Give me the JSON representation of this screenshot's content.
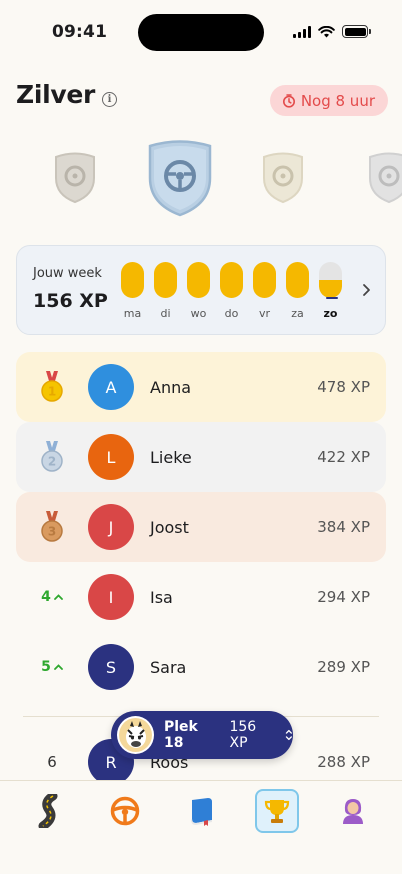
{
  "status": {
    "time": "09:41"
  },
  "header": {
    "title": "Zilver",
    "info_icon": "info-icon",
    "timer_label": "Nog 8 uur",
    "timer_color": "#e34b4b"
  },
  "leagues": [
    {
      "name": "brons-shield",
      "state": "locked"
    },
    {
      "name": "zilver-shield",
      "state": "current"
    },
    {
      "name": "goud-shield",
      "state": "locked"
    },
    {
      "name": "platina-shield",
      "state": "locked"
    }
  ],
  "week": {
    "label": "Jouw week",
    "xp": "156 XP",
    "days": [
      {
        "label": "ma",
        "progress": 1.0
      },
      {
        "label": "di",
        "progress": 1.0
      },
      {
        "label": "wo",
        "progress": 1.0
      },
      {
        "label": "do",
        "progress": 1.0
      },
      {
        "label": "vr",
        "progress": 1.0
      },
      {
        "label": "za",
        "progress": 1.0
      },
      {
        "label": "zo",
        "progress": 0.5
      }
    ]
  },
  "leaderboard": {
    "rows": [
      {
        "rank": "1",
        "initial": "A",
        "name": "Anna",
        "xp": "478 XP",
        "avatar_color": "#2f8fde",
        "medal": "gold-medal-icon"
      },
      {
        "rank": "2",
        "initial": "L",
        "name": "Lieke",
        "xp": "422 XP",
        "avatar_color": "#e8650f",
        "medal": "silver-medal-icon"
      },
      {
        "rank": "3",
        "initial": "J",
        "name": "Joost",
        "xp": "384 XP",
        "avatar_color": "#d94747",
        "medal": "bronze-medal-icon"
      },
      {
        "rank": "4",
        "initial": "I",
        "name": "Isa",
        "xp": "294 XP",
        "avatar_color": "#d94747"
      },
      {
        "rank": "5",
        "initial": "S",
        "name": "Sara",
        "xp": "289 XP",
        "avatar_color": "#2b3280"
      },
      {
        "rank": "6",
        "initial": "R",
        "name": "Roos",
        "xp": "288 XP",
        "avatar_color": "#2b3280"
      }
    ]
  },
  "user_position": {
    "label": "Plek 18",
    "xp": "156 XP",
    "avatar_icon": "zebra-avatar-icon"
  },
  "tabs": [
    {
      "name": "road-icon",
      "active": false
    },
    {
      "name": "steering-wheel-icon",
      "active": false
    },
    {
      "name": "book-icon",
      "active": false
    },
    {
      "name": "trophy-icon",
      "active": true
    },
    {
      "name": "profile-avatar-icon",
      "active": false
    }
  ],
  "colors": {
    "accent_yellow": "#f5b800",
    "navy": "#2b3280",
    "background": "#fbf9f4"
  }
}
